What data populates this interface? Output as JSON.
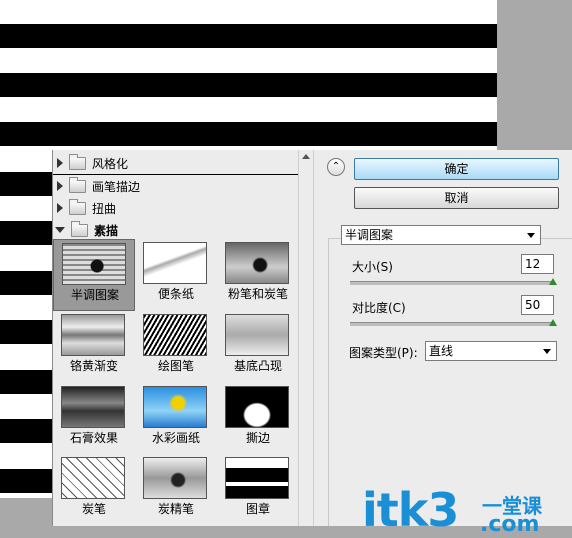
{
  "categories": [
    {
      "label": "风格化",
      "expanded": false
    },
    {
      "label": "画笔描边",
      "expanded": false
    },
    {
      "label": "扭曲",
      "expanded": false
    },
    {
      "label": "素描",
      "expanded": true
    }
  ],
  "filters": [
    {
      "label": "半调图案",
      "selected": true
    },
    {
      "label": "便条纸",
      "selected": false
    },
    {
      "label": "粉笔和炭笔",
      "selected": false
    },
    {
      "label": "铬黄渐变",
      "selected": false
    },
    {
      "label": "绘图笔",
      "selected": false
    },
    {
      "label": "基底凸现",
      "selected": false
    },
    {
      "label": "石膏效果",
      "selected": false
    },
    {
      "label": "水彩画纸",
      "selected": false
    },
    {
      "label": "撕边",
      "selected": false
    },
    {
      "label": "炭笔",
      "selected": false
    },
    {
      "label": "炭精笔",
      "selected": false
    },
    {
      "label": "图章",
      "selected": false
    }
  ],
  "buttons": {
    "ok": "确定",
    "cancel": "取消",
    "collapse": "⌃"
  },
  "filter_select": {
    "value": "半调图案"
  },
  "params": {
    "size": {
      "label": "大小(S)",
      "value": "12",
      "slider": 1.0
    },
    "contrast": {
      "label": "对比度(C)",
      "value": "50",
      "slider": 1.0
    },
    "pattern": {
      "label": "图案类型(P):",
      "value": "直线"
    }
  },
  "watermark": {
    "main": "itk3",
    "cn": "一堂课",
    "com": ".com"
  },
  "colors": {
    "accent": "#1a8fd6",
    "slider_knob": "#2e8b2e",
    "primary_button": "#a8daf6"
  }
}
